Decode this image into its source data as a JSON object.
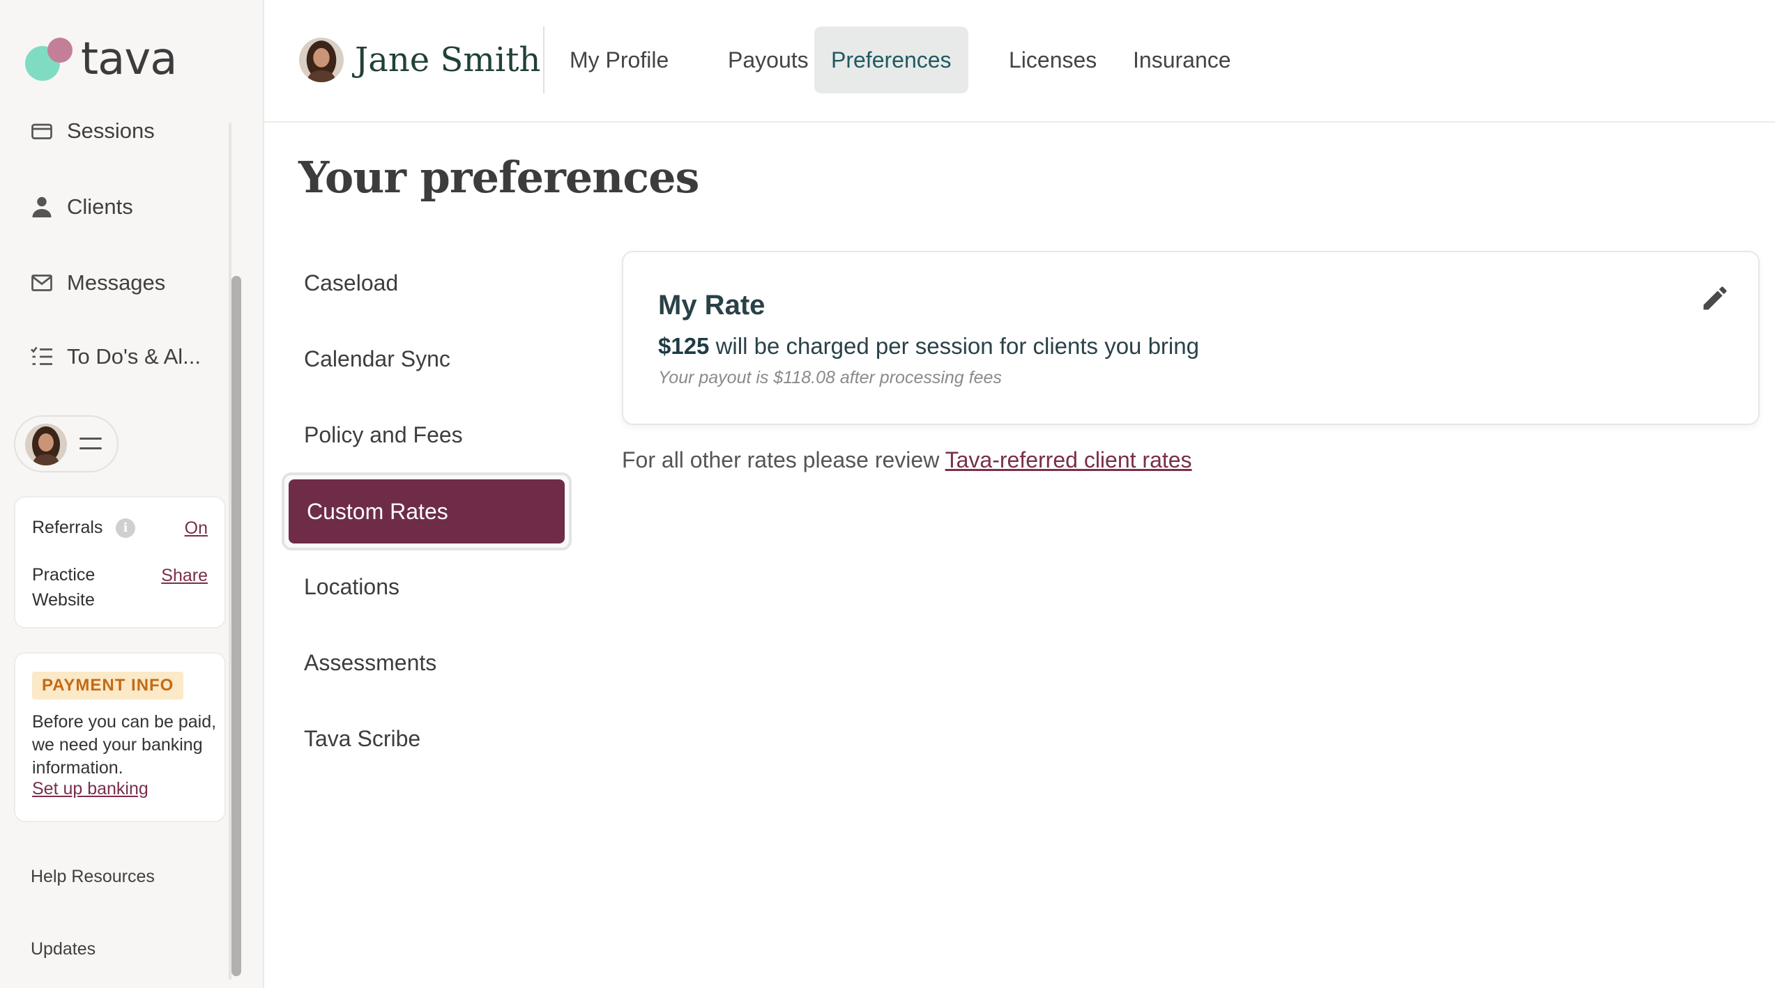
{
  "brand": {
    "name": "tava"
  },
  "sidebar": {
    "nav": [
      {
        "label": "Sessions",
        "icon": "card-icon"
      },
      {
        "label": "Clients",
        "icon": "person-icon"
      },
      {
        "label": "Messages",
        "icon": "envelope-icon"
      },
      {
        "label": "To Do's & Al...",
        "icon": "checklist-icon"
      }
    ],
    "referrals": {
      "label": "Referrals",
      "status_link": "On"
    },
    "practice_website": {
      "label_line1": "Practice",
      "label_line2": "Website",
      "action_link": "Share"
    },
    "payment_info": {
      "badge": "PAYMENT INFO",
      "text": "Before you can be paid, we need your banking information.",
      "link": "Set up banking"
    },
    "footer": {
      "help": "Help Resources",
      "updates": "Updates"
    }
  },
  "topbar": {
    "user_name": "Jane Smith",
    "tabs": [
      {
        "label": "My Profile",
        "active": false
      },
      {
        "label": "Payouts",
        "active": false
      },
      {
        "label": "Preferences",
        "active": true
      },
      {
        "label": "Licenses",
        "active": false
      },
      {
        "label": "Insurance",
        "active": false
      }
    ]
  },
  "main": {
    "title": "Your preferences",
    "pref_nav": [
      {
        "label": "Caseload"
      },
      {
        "label": "Calendar Sync"
      },
      {
        "label": "Policy and Fees"
      },
      {
        "label": "Custom Rates",
        "active": true
      },
      {
        "label": "Locations"
      },
      {
        "label": "Assessments"
      },
      {
        "label": "Tava Scribe"
      }
    ],
    "rate_card": {
      "title": "My Rate",
      "amount": "$125",
      "description": " will be charged per session for clients you bring",
      "payout_note": "Your payout is $118.08 after processing fees"
    },
    "other_rates": {
      "text": "For all other rates please review ",
      "link": "Tava-referred client rates"
    }
  },
  "colors": {
    "accent": "#6e2c49",
    "link": "#7a2e4b",
    "active_tab_bg": "#e8eae9",
    "active_tab_text": "#1f5a63",
    "badge_bg": "#fbe9c8",
    "badge_text": "#c46a14",
    "logo_mint": "#7fdcc2",
    "logo_pink": "#c47f98"
  }
}
